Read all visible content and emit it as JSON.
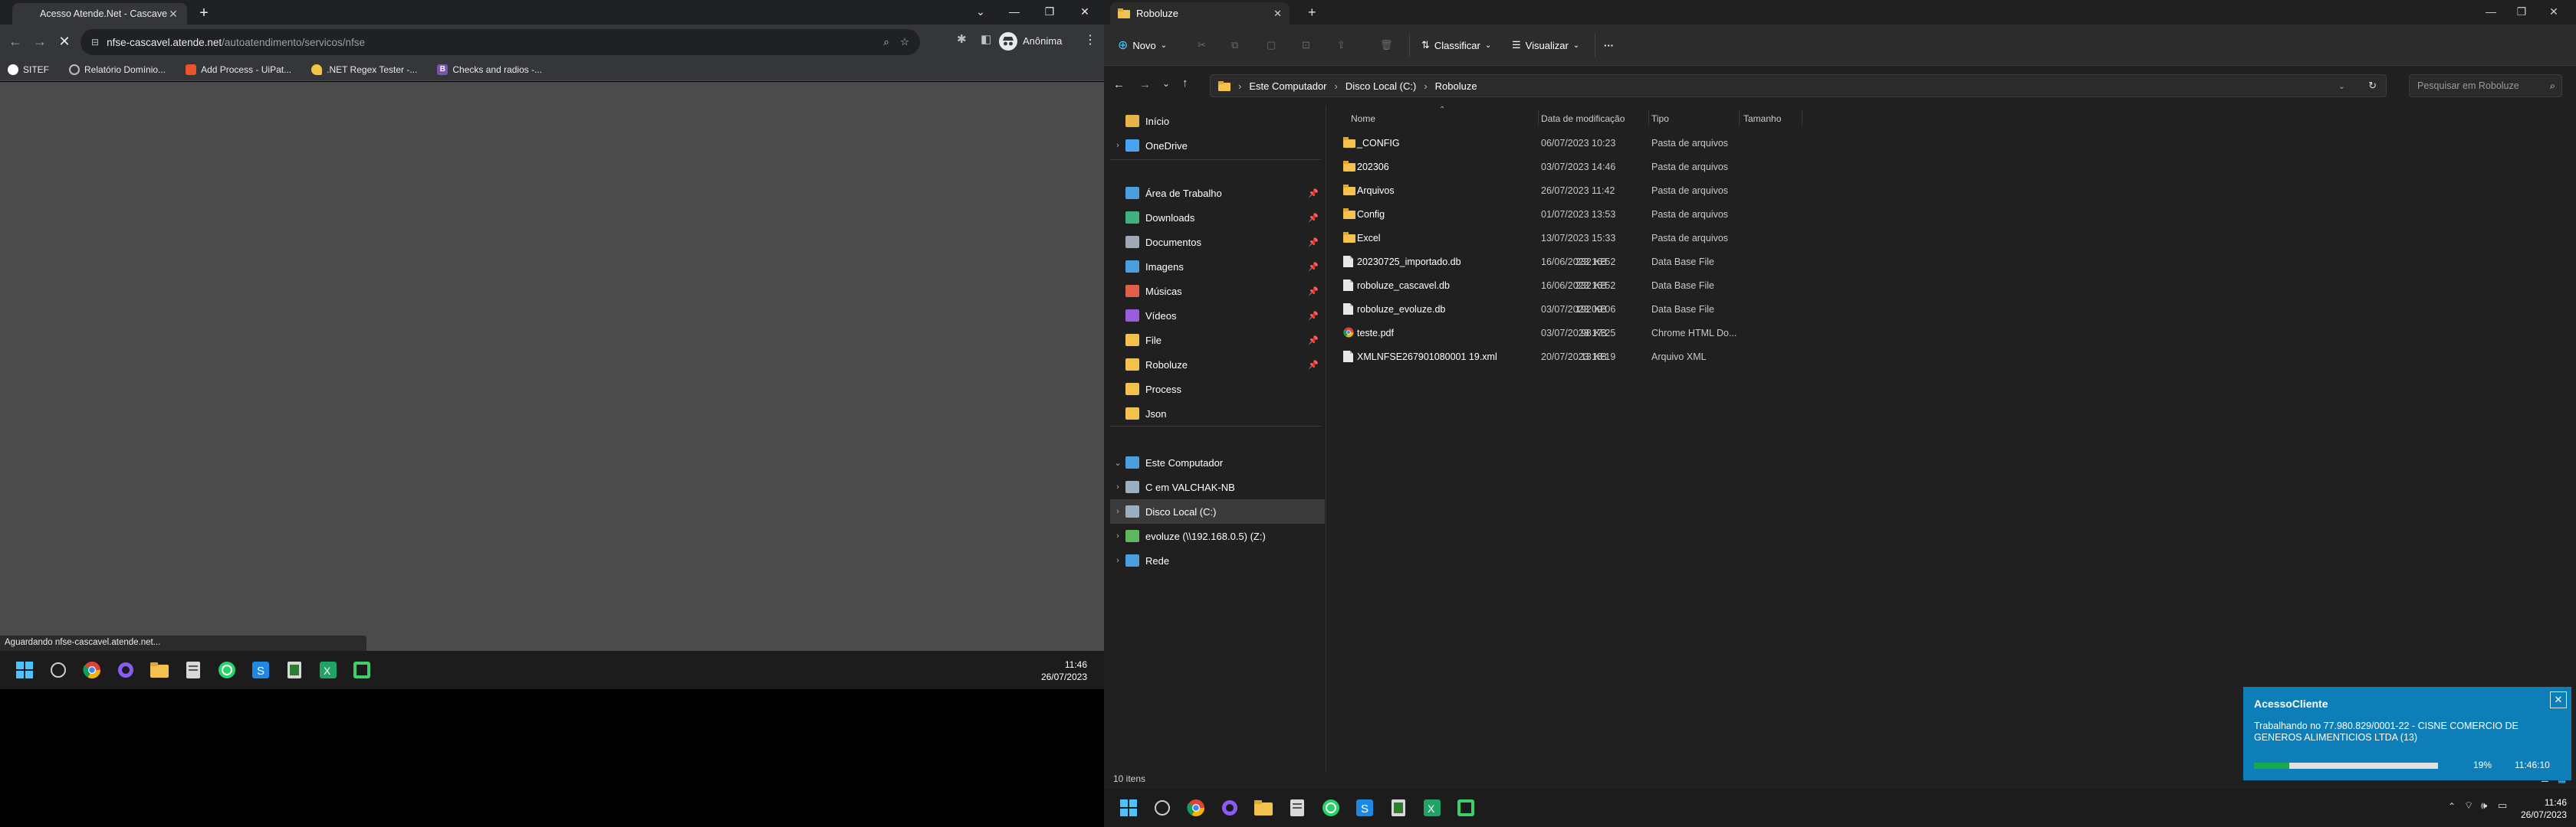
{
  "chrome": {
    "tab_title": "Acesso Atende.Net - Cascavel/PR",
    "url_domain": "nfse-cascavel.atende.net",
    "url_path": "/autoatendimento/servicos/nfse",
    "profile": "Anônima",
    "bookmarks": [
      {
        "label": "SITEF",
        "icon": "sitef-icon",
        "color": "#ffffff"
      },
      {
        "label": "Relatório Domínio...",
        "icon": "globe-icon",
        "color": "#bbbbbb"
      },
      {
        "label": "Add Process - UiPat...",
        "icon": "uipath-icon",
        "color": "#e8562a"
      },
      {
        "label": ".NET Regex Tester -...",
        "icon": "regex-icon",
        "color": "#f4c542"
      },
      {
        "label": "Checks and radios -...",
        "icon": "bootstrap-icon",
        "color": "#7952b3"
      }
    ],
    "status_text": "Aguardando nfse-cascavel.atende.net..."
  },
  "taskbar_left": {
    "time": "11:46",
    "date": "26/07/2023"
  },
  "explorer": {
    "tab_title": "Roboluze",
    "commands": {
      "new": "Novo",
      "sort": "Classificar",
      "view": "Visualizar",
      "more": "···"
    },
    "breadcrumb": [
      "Este Computador",
      "Disco Local (C:)",
      "Roboluze"
    ],
    "search_placeholder": "Pesquisar em Roboluze",
    "nav": [
      {
        "label": "Início",
        "icon": "home-icon",
        "color": "#e6b54a",
        "chev": "",
        "pin": false
      },
      {
        "label": "OneDrive",
        "icon": "cloud-icon",
        "color": "#4aa3f0",
        "chev": "›",
        "pin": false
      },
      {
        "label": "Área de Trabalho",
        "icon": "desktop-icon",
        "color": "#4a9fe0",
        "chev": "",
        "pin": true
      },
      {
        "label": "Downloads",
        "icon": "download-icon",
        "color": "#3fb27f",
        "chev": "",
        "pin": true
      },
      {
        "label": "Documentos",
        "icon": "documents-icon",
        "color": "#a0a8b8",
        "chev": "",
        "pin": true
      },
      {
        "label": "Imagens",
        "icon": "pictures-icon",
        "color": "#4a9fe0",
        "chev": "",
        "pin": true
      },
      {
        "label": "Músicas",
        "icon": "music-icon",
        "color": "#e0604a",
        "chev": "",
        "pin": true
      },
      {
        "label": "Vídeos",
        "icon": "videos-icon",
        "color": "#9a5de0",
        "chev": "",
        "pin": true
      },
      {
        "label": "File",
        "icon": "folder-icon",
        "color": "#f2c14e",
        "chev": "",
        "pin": true
      },
      {
        "label": "Roboluze",
        "icon": "folder-icon",
        "color": "#f2c14e",
        "chev": "",
        "pin": true
      },
      {
        "label": "Process",
        "icon": "folder-icon",
        "color": "#f2c14e",
        "chev": "",
        "pin": false
      },
      {
        "label": "Json",
        "icon": "folder-icon",
        "color": "#f2c14e",
        "chev": "",
        "pin": false
      },
      {
        "label": "Este Computador",
        "icon": "computer-icon",
        "color": "#4a9fe0",
        "chev": "⌄",
        "pin": false
      },
      {
        "label": "C em VALCHAK-NB",
        "icon": "drive-icon",
        "color": "#9ab0c0",
        "chev": "›",
        "pin": false
      },
      {
        "label": "Disco Local (C:)",
        "icon": "drive-icon",
        "color": "#9ab0c0",
        "chev": "›",
        "pin": false
      },
      {
        "label": "evoluze (\\\\192.168.0.5) (Z:)",
        "icon": "network-drive-icon",
        "color": "#5fb85f",
        "chev": "›",
        "pin": false
      },
      {
        "label": "Rede",
        "icon": "network-icon",
        "color": "#4a9fe0",
        "chev": "›",
        "pin": false
      }
    ],
    "columns": {
      "name": "Nome",
      "date": "Data de modificação",
      "type": "Tipo",
      "size": "Tamanho"
    },
    "files": [
      {
        "name": "_CONFIG",
        "date": "06/07/2023 10:23",
        "type": "Pasta de arquivos",
        "size": "",
        "icon": "folder-icon"
      },
      {
        "name": "202306",
        "date": "03/07/2023 14:46",
        "type": "Pasta de arquivos",
        "size": "",
        "icon": "folder-icon"
      },
      {
        "name": "Arquivos",
        "date": "26/07/2023 11:42",
        "type": "Pasta de arquivos",
        "size": "",
        "icon": "folder-icon"
      },
      {
        "name": "Config",
        "date": "01/07/2023 13:53",
        "type": "Pasta de arquivos",
        "size": "",
        "icon": "folder-icon"
      },
      {
        "name": "Excel",
        "date": "13/07/2023 15:33",
        "type": "Pasta de arquivos",
        "size": "",
        "icon": "folder-icon"
      },
      {
        "name": "20230725_importado.db",
        "date": "16/06/2023 16:52",
        "type": "Data Base File",
        "size": "232 KB",
        "icon": "file-icon"
      },
      {
        "name": "roboluze_cascavel.db",
        "date": "16/06/2023 16:52",
        "type": "Data Base File",
        "size": "232 KB",
        "icon": "file-icon"
      },
      {
        "name": "roboluze_evoluze.db",
        "date": "03/07/2023 09:06",
        "type": "Data Base File",
        "size": "192 KB",
        "icon": "file-icon"
      },
      {
        "name": "teste.pdf",
        "date": "03/07/2023 17:25",
        "type": "Chrome HTML Do...",
        "size": "98 KB",
        "icon": "chrome-icon"
      },
      {
        "name": "XMLNFSE267901080001 19.xml",
        "date": "20/07/2023 18:19",
        "type": "Arquivo XML",
        "size": "13 KB",
        "icon": "file-icon"
      }
    ],
    "item_count": "10 itens"
  },
  "toast": {
    "title": "AcessoCliente",
    "message": "Trabalhando no 77.980.829/0001-22 - CISNE COMERCIO DE GENEROS ALIMENTICIOS LTDA (13)",
    "progress": 0.19,
    "percent_label": "19%",
    "time": "11:46:10"
  },
  "taskbar_right": {
    "time": "11:46",
    "date": "26/07/2023"
  }
}
